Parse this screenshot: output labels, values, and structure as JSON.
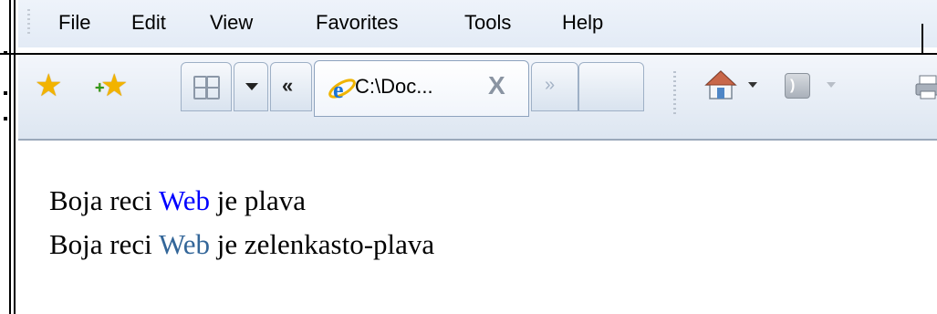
{
  "menu": {
    "file": "File",
    "edit": "Edit",
    "view": "View",
    "favorites": "Favorites",
    "tools": "Tools",
    "help": "Help"
  },
  "toolbar": {
    "favorites_icon": "star-icon",
    "add_favorite_icon": "add-star-icon",
    "quick_tabs_icon": "quick-tabs-icon",
    "tab_list_icon": "chevron-down-icon",
    "scroll_left_label": "«",
    "active_tab": {
      "title": "C:\\Doc...",
      "close_label": "X",
      "icon": "ie-icon"
    },
    "scroll_right_label": "»",
    "home_icon": "home-icon",
    "feeds_icon": "rss-icon",
    "print_icon": "printer-icon"
  },
  "content": {
    "line1": {
      "before": "Boja reci ",
      "highlight": "Web",
      "after": " je plava",
      "highlight_color": "#0000ff"
    },
    "line2": {
      "before": "Boja reci ",
      "highlight": "Web",
      "after": " je zelenkasto-plava",
      "highlight_color": "#336699"
    }
  }
}
